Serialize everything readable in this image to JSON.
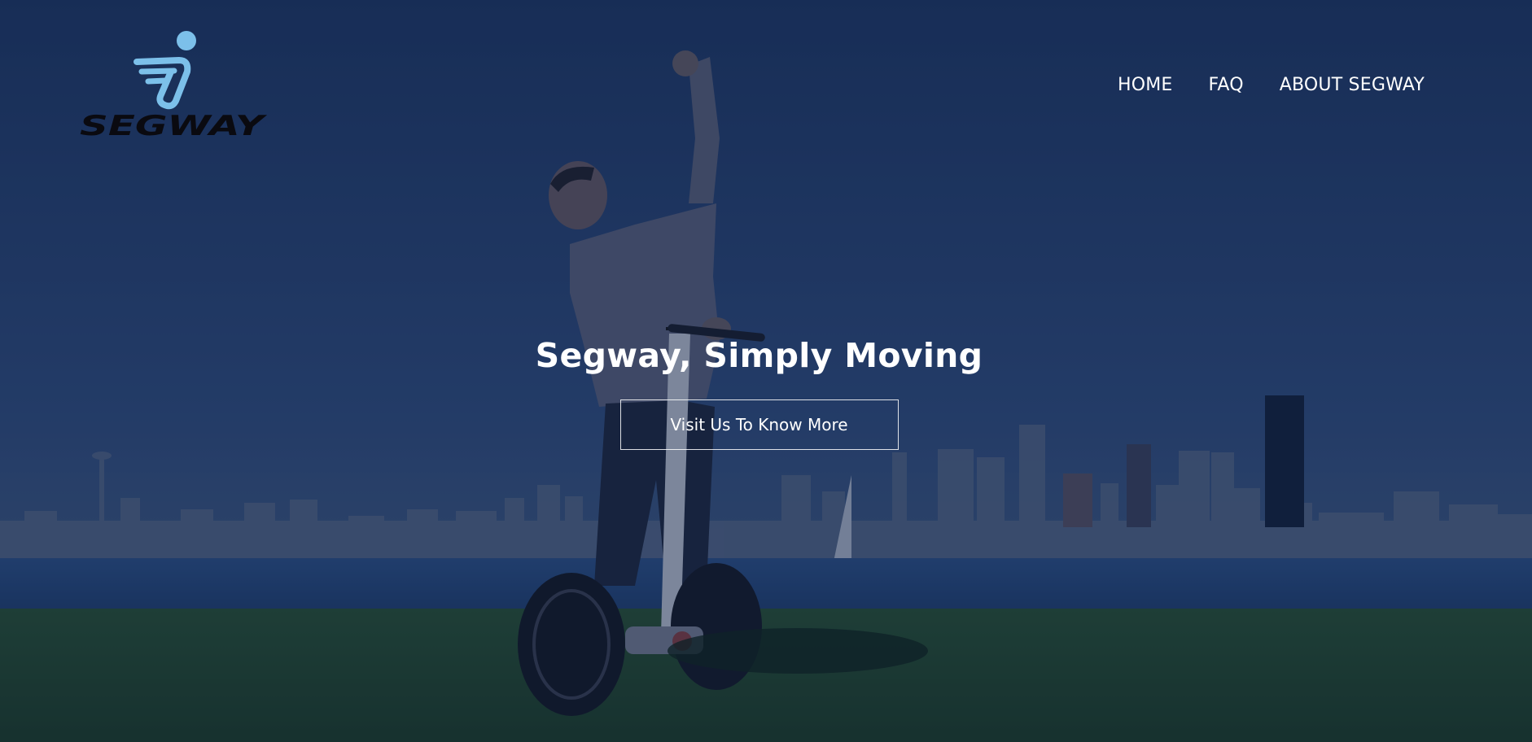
{
  "brand": {
    "name": "SEGWAY",
    "logo_color": "#7cc0ea"
  },
  "nav": {
    "items": [
      {
        "label": "HOME"
      },
      {
        "label": "FAQ"
      },
      {
        "label": "ABOUT SEGWAY"
      }
    ]
  },
  "hero": {
    "title": "Segway, Simply Moving",
    "cta_label": "Visit Us To Know More",
    "overlay_color": "#1c2f5a",
    "background_image": "rider-on-segway-over-city-skyline-photo"
  },
  "colors": {
    "text": "#ffffff",
    "sky": "#2a4777",
    "grass": "#1d3d1a",
    "water": "#274a7b"
  }
}
